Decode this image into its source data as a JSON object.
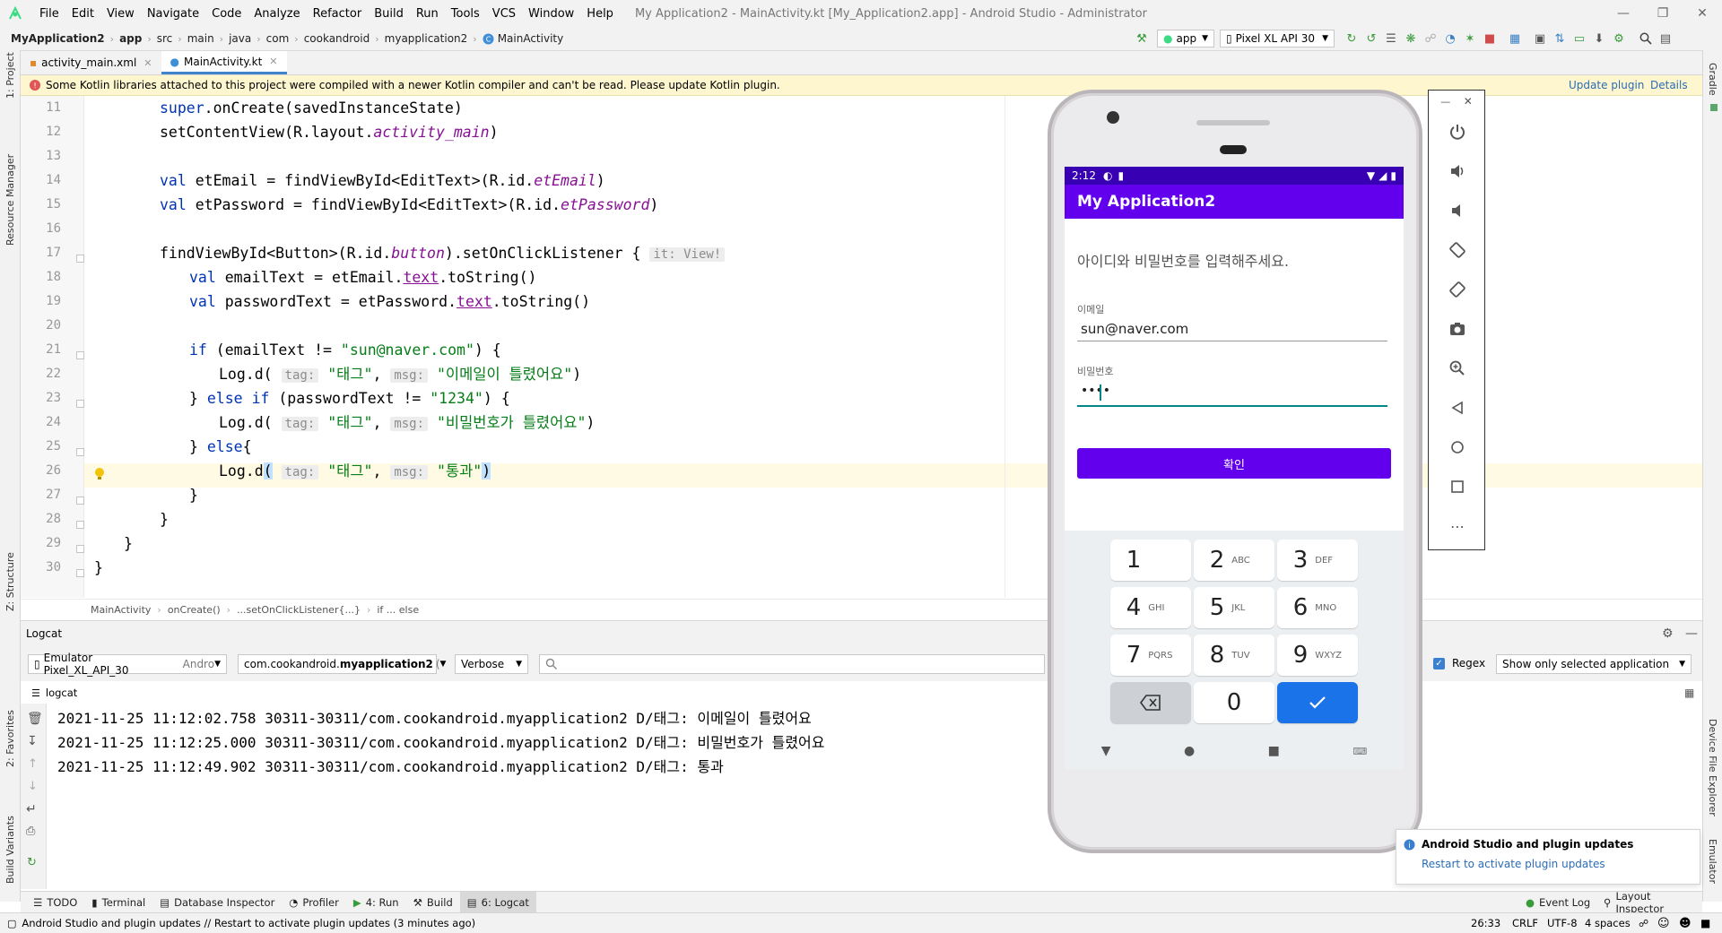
{
  "window": {
    "menu": [
      "File",
      "Edit",
      "View",
      "Navigate",
      "Code",
      "Analyze",
      "Refactor",
      "Build",
      "Run",
      "Tools",
      "VCS",
      "Window",
      "Help"
    ],
    "title": "My Application2 - MainActivity.kt [My_Application2.app] - Android Studio - Administrator"
  },
  "breadcrumb": [
    "MyApplication2",
    "app",
    "src",
    "main",
    "java",
    "com",
    "cookandroid",
    "myapplication2",
    "MainActivity"
  ],
  "toolbar": {
    "config": "app",
    "device": "Pixel XL API 30"
  },
  "left_tools": [
    "1: Project",
    "Resource Manager",
    "Z: Structure",
    "2: Favorites",
    "Build Variants"
  ],
  "right_tools": [
    "Gradle",
    "Device File Explorer",
    "Emulator"
  ],
  "tabs": [
    {
      "label": "activity_main.xml",
      "active": false
    },
    {
      "label": "MainActivity.kt",
      "active": true
    }
  ],
  "banner": {
    "message": "Some Kotlin libraries attached to this project were compiled with a newer Kotlin compiler and can't be read. Please update Kotlin plugin.",
    "update": "Update plugin",
    "details": "Details"
  },
  "code": {
    "line_numbers": [
      "11",
      "12",
      "13",
      "14",
      "15",
      "16",
      "17",
      "18",
      "19",
      "20",
      "21",
      "22",
      "23",
      "24",
      "25",
      "26",
      "27",
      "28",
      "29",
      "30"
    ],
    "t": {
      "l11a": "super",
      "l11b": ".onCreate(savedInstanceState)",
      "l12a": "setContentView(R.layout.",
      "l12b": "activity_main",
      "l12c": ")",
      "val": "val",
      "l14a": " etEmail = findViewById<EditText>(R.id.",
      "l14b": "etEmail",
      "l14c": ")",
      "l15a": " etPassword = findViewById<EditText>(R.id.",
      "l15b": "etPassword",
      "l15c": ")",
      "l17a": "findViewById<Button>(R.id.",
      "l17b": "button",
      "l17c": ").setOnClickListener {",
      "l17hint": "it: View!",
      "l18a": " emailText = etEmail.",
      "text": "text",
      "tostring": ".toString()",
      "l19a": " passwordText = etPassword.",
      "if": "if",
      "l21a": " (emailText != ",
      "l21b": "\"sun@naver.com\"",
      "l21c": ") {",
      "logd": "Log.d(",
      "tag_hint": "tag:",
      "msg_hint": "msg:",
      "tag_val": "\"태그\"",
      "comma": ",",
      "l22msg": "\"이메일이 틀렸어요\"",
      "close": ")",
      "l23a": "} ",
      "else": "else",
      "l23b": " (passwordText != ",
      "l23c": "\"1234\"",
      "l23d": ") {",
      "l24msg": "\"비밀번호가 틀렸어요\"",
      "l25a": "} ",
      "l25b": "{",
      "l26a": "Log.d",
      "l26paren": "(",
      "l26msg": "\"통과\"",
      "l26close": ")",
      "rbrace": "}"
    }
  },
  "editor_breadcrumbs": [
    "MainActivity",
    "onCreate()",
    "...setOnClickListener{...}",
    "if ... else"
  ],
  "logcat": {
    "title": "Logcat",
    "device": "Emulator Pixel_XL_API_30",
    "device_suffix": "Andro",
    "process_prefix": "com.cookandroid.",
    "process_bold": "myapplication2",
    "process_suffix": "(",
    "level": "Verbose",
    "regex": "Regex",
    "filter": "Show only selected application",
    "sub_tab": "logcat",
    "lines": [
      "2021-11-25 11:12:02.758 30311-30311/com.cookandroid.myapplication2 D/태그: 이메일이 틀렸어요",
      "2021-11-25 11:12:25.000 30311-30311/com.cookandroid.myapplication2 D/태그: 비밀번호가 틀렸어요",
      "2021-11-25 11:12:49.902 30311-30311/com.cookandroid.myapplication2 D/태그: 통과"
    ]
  },
  "bottom_tools": [
    {
      "label": "TODO",
      "icon": "list-icon"
    },
    {
      "label": "Terminal",
      "icon": "terminal-icon"
    },
    {
      "label": "Database Inspector",
      "icon": "database-icon"
    },
    {
      "label": "Profiler",
      "icon": "profiler-icon"
    },
    {
      "label": "4: Run",
      "icon": "run-icon"
    },
    {
      "label": "Build",
      "icon": "hammer-icon"
    },
    {
      "label": "6: Logcat",
      "icon": "logcat-icon",
      "active": true
    }
  ],
  "bottom_right": [
    "Event Log",
    "Layout Inspector"
  ],
  "status": {
    "message": "Android Studio and plugin updates // Restart to activate plugin updates (3 minutes ago)",
    "position": "26:33",
    "line_sep": "CRLF",
    "encoding": "UTF-8",
    "indent": "4 spaces"
  },
  "phone": {
    "time": "2:12",
    "app_title": "My Application2",
    "prompt": "아이디와 비밀번호를 입력해주세요.",
    "email_label": "이메일",
    "email_value": "sun@naver.com",
    "password_label": "비밀번호",
    "password_value": "••••",
    "confirm": "확인",
    "keys": [
      {
        "d": "1",
        "l": ""
      },
      {
        "d": "2",
        "l": "ABC"
      },
      {
        "d": "3",
        "l": "DEF"
      },
      {
        "d": "4",
        "l": "GHI"
      },
      {
        "d": "5",
        "l": "JKL"
      },
      {
        "d": "6",
        "l": "MNO"
      },
      {
        "d": "7",
        "l": "PQRS"
      },
      {
        "d": "8",
        "l": "TUV"
      },
      {
        "d": "9",
        "l": "WXYZ"
      },
      {
        "d": "0",
        "l": ""
      }
    ]
  },
  "notification": {
    "title": "Android Studio and plugin updates",
    "link": "Restart to activate plugin updates"
  },
  "colors": {
    "accent": "#6200ee",
    "status_bar": "#3700b3",
    "teal": "#018786",
    "link": "#2a6cb6"
  }
}
